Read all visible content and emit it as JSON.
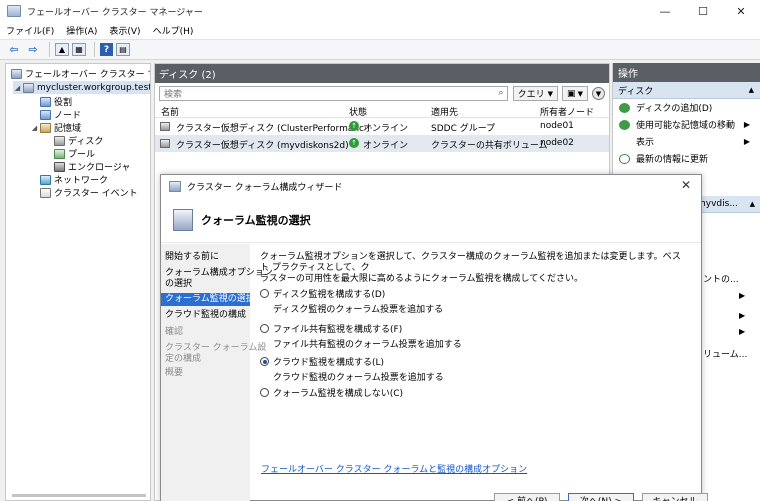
{
  "window": {
    "title": "フェールオーバー クラスター マネージャー",
    "minimize": "—",
    "maximize": "☐",
    "close": "✕"
  },
  "menu": [
    "ファイル(F)",
    "操作(A)",
    "表示(V)",
    "ヘルプ(H)"
  ],
  "tree": {
    "root": "フェールオーバー クラスター マネージャー",
    "cluster": "mycluster.workgroup.test",
    "roles": "役割",
    "nodes": "ノード",
    "storage": "記憶域",
    "disks": "ディスク",
    "pools": "プール",
    "enclosures": "エンクロージャ",
    "networks": "ネットワーク",
    "events": "クラスター イベント"
  },
  "center": {
    "header": "ディスク (2)",
    "search_placeholder": "検索",
    "query_label": "クエリ",
    "columns": [
      "名前",
      "状態",
      "適用先",
      "所有者ノード"
    ],
    "rows": [
      {
        "name": "クラスター仮想ディスク (ClusterPerformanc···",
        "status": "オンライン",
        "assigned": "SDDC グループ",
        "owner": "node01"
      },
      {
        "name": "クラスター仮想ディスク (myvdiskons2d)",
        "status": "オンライン",
        "assigned": "クラスターの共有ボリューム",
        "owner": "node02"
      }
    ]
  },
  "actions": {
    "header": "操作",
    "section": "ディスク",
    "items": [
      {
        "label": "ディスクの追加(D)",
        "icon": "add-disk-icon"
      },
      {
        "label": "使用可能な記憶域の移動",
        "icon": "move-storage-icon",
        "more": "▶"
      },
      {
        "label": "表示",
        "icon": "",
        "more": "▶"
      },
      {
        "label": "最新の情報に更新",
        "icon": "refresh-icon"
      }
    ],
    "section2_partial": "myvdis...",
    "partial_1": "ントの...",
    "partial_2": "リューム..."
  },
  "wizard": {
    "title": "クラスター クォーラム構成ウィザード",
    "banner_title": "クォーラム監視の選択",
    "steps": [
      {
        "label": "開始する前に",
        "state": "normal"
      },
      {
        "label": "クォーラム構成オプション",
        "label2": "の選択",
        "state": "normal"
      },
      {
        "label": "クォーラム監視の選択",
        "state": "active"
      },
      {
        "label": "クラウド監視の構成",
        "state": "normal"
      },
      {
        "label": "確認",
        "state": "disabled"
      },
      {
        "label": "クラスター クォーラム設",
        "label2": "定の構成",
        "state": "disabled"
      },
      {
        "label": "概要",
        "state": "disabled"
      }
    ],
    "description_1": "クォーラム監視オプションを選択して、クラスター構成のクォーラム監視を追加または変更します。ベスト プラクティスとして、ク",
    "description_2": "ラスターの可用性を最大限に高めるようにクォーラム監視を構成してください。",
    "options": [
      {
        "label": "ディスク監視を構成する(D)",
        "detail": "ディスク監視のクォーラム投票を追加する",
        "selected": false
      },
      {
        "label": "ファイル共有監視を構成する(F)",
        "detail": "ファイル共有監視のクォーラム投票を追加する",
        "selected": false
      },
      {
        "label": "クラウド監視を構成する(L)",
        "detail": "クラウド監視のクォーラム投票を追加する",
        "selected": true
      },
      {
        "label": "クォーラム監視を構成しない(C)",
        "detail": "",
        "selected": false
      }
    ],
    "link": "フェールオーバー クラスター クォーラムと監視の構成オプション",
    "buttons": {
      "back": "< 前へ(P)",
      "next": "次へ(N) >",
      "cancel": "キャンセル"
    }
  }
}
